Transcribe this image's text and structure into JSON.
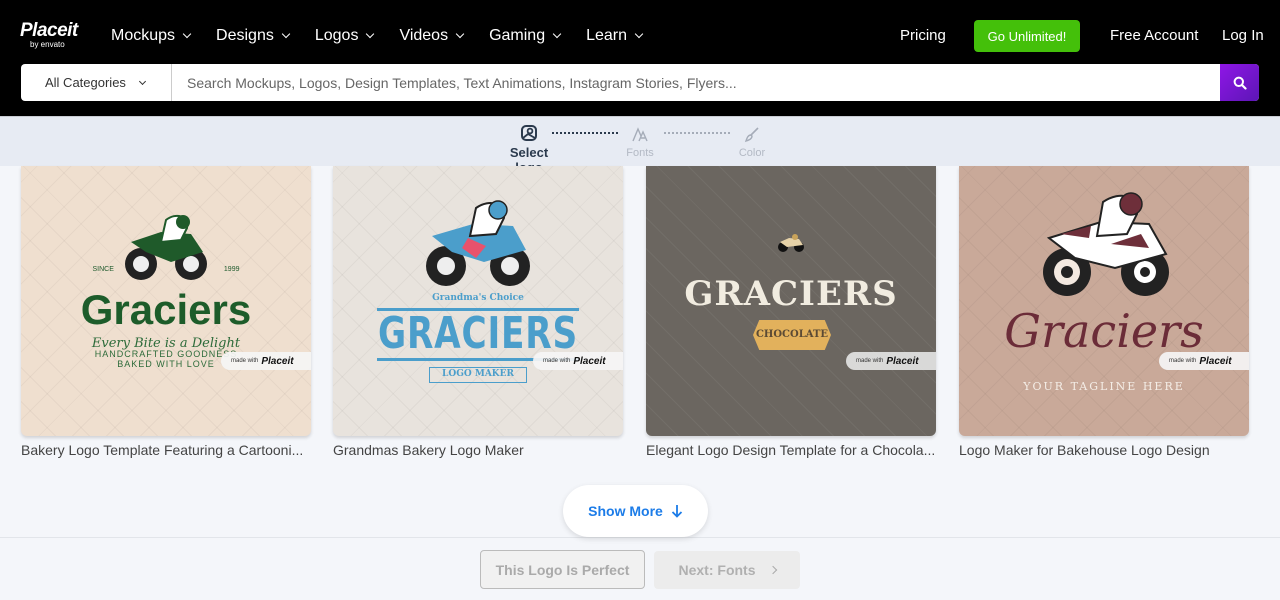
{
  "header": {
    "logo": {
      "brand": "Placeit",
      "byline": "by envato"
    },
    "nav": [
      {
        "label": "Mockups"
      },
      {
        "label": "Designs"
      },
      {
        "label": "Logos"
      },
      {
        "label": "Videos"
      },
      {
        "label": "Gaming"
      },
      {
        "label": "Learn"
      }
    ],
    "pricing": "Pricing",
    "go_unlimited": "Go Unlimited!",
    "free_account": "Free Account",
    "login": "Log In",
    "colors": {
      "go_unlimited_bg": "#44c00a",
      "search_button_bg": "#7a16d6"
    }
  },
  "search": {
    "category": "All Categories",
    "placeholder": "Search Mockups, Logos, Design Templates, Text Animations, Instagram Stories, Flyers...",
    "value": ""
  },
  "steps": [
    {
      "label": "Select logo",
      "icon": "logo-image-icon",
      "state": "active"
    },
    {
      "label": "Fonts",
      "icon": "font-icon",
      "state": "inactive"
    },
    {
      "label": "Color",
      "icon": "brush-icon",
      "state": "inactive"
    }
  ],
  "cards": [
    {
      "title": "Bakery Logo Template Featuring a Cartooni...",
      "bg": "#efdfcf",
      "logo": {
        "since": "SINCE",
        "year": "1999",
        "name": "Graciers",
        "script": "Every Bite is a Delight",
        "line1": "HANDCRAFTED GOODNESS",
        "line2": "BAKED WITH LOVE"
      }
    },
    {
      "title": "Grandmas Bakery Logo Maker",
      "bg": "#e8e3dd",
      "logo": {
        "top": "Grandma's Choice",
        "name": "GRACIERS",
        "ribbon": "LOGO MAKER"
      }
    },
    {
      "title": "Elegant Logo Design Template for a Chocola...",
      "bg": "#6b6660",
      "logo": {
        "name": "GRACIERS",
        "badge": "CHOCOLATE"
      }
    },
    {
      "title": "Logo Maker for Bakehouse Logo Design",
      "bg": "#c9a999",
      "logo": {
        "name": "Graciers",
        "tagline": "YOUR TAGLINE HERE"
      }
    }
  ],
  "watermark": {
    "prefix": "made with",
    "brand": "Placeit"
  },
  "show_more": "Show More",
  "footer": {
    "perfect_button": "This Logo Is Perfect",
    "next_button": "Next: Fonts"
  }
}
